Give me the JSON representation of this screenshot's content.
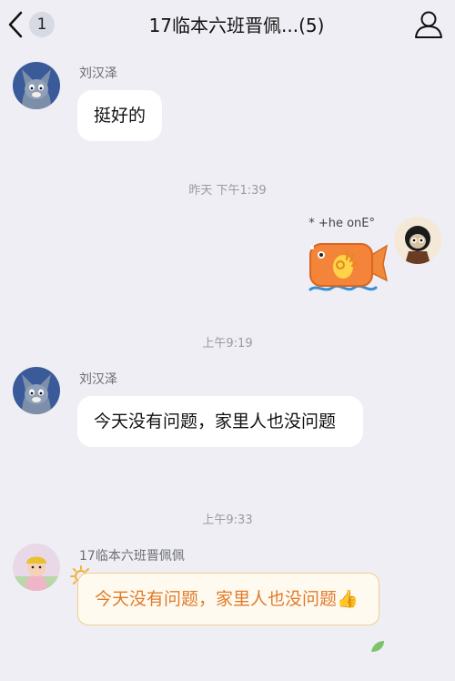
{
  "header": {
    "unread_count": "1",
    "title": "17临本六班晋佩...(5)"
  },
  "messages": [
    {
      "sender": "刘汉泽",
      "text": "挺好的"
    },
    {
      "time": "昨天 下午1:39"
    },
    {
      "sender": "* +he onE°",
      "sticker": "fish-ok-sticker"
    },
    {
      "time": "上午9:19"
    },
    {
      "sender": "刘汉泽",
      "text": "今天没有问题，家里人也没问题"
    },
    {
      "time": "上午9:33"
    },
    {
      "sender": "17临本六班晋佩佩",
      "text": "今天没有问题，家里人也没问题",
      "emoji": "👍"
    }
  ],
  "colors": {
    "background": "#eeeef4",
    "bubble": "#ffffff",
    "special_bubble_text": "#e07b2a",
    "special_bubble_border": "#f0cf8f"
  }
}
